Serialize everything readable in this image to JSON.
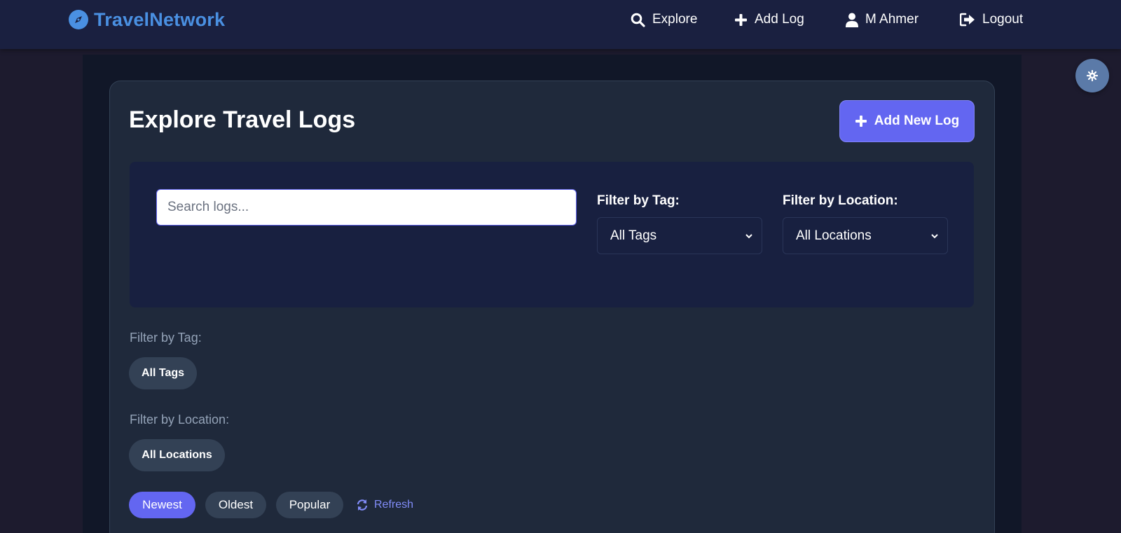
{
  "brand": {
    "name": "TravelNetwork",
    "icon": "compass-icon",
    "color": "#4a90e2"
  },
  "nav": {
    "items": [
      {
        "label": "Explore",
        "icon": "search-icon"
      },
      {
        "label": "Add Log",
        "icon": "plus-icon"
      },
      {
        "label": "M Ahmer",
        "icon": "user-icon"
      },
      {
        "label": "Logout",
        "icon": "logout-icon"
      }
    ]
  },
  "page": {
    "title": "Explore Travel Logs",
    "add_button_label": "Add New Log"
  },
  "filters": {
    "search_placeholder": "Search logs...",
    "tag_label": "Filter by Tag:",
    "tag_selected": "All Tags",
    "location_label": "Filter by Location:",
    "location_selected": "All Locations"
  },
  "tag_pills": {
    "label": "Filter by Tag:",
    "items": [
      "All Tags"
    ]
  },
  "location_pills": {
    "label": "Filter by Location:",
    "items": [
      "All Locations"
    ]
  },
  "sort": {
    "options": [
      "Newest",
      "Oldest",
      "Popular"
    ],
    "active": "Newest",
    "refresh_label": "Refresh"
  },
  "theme_toggle": {
    "icon": "gear-icon"
  },
  "colors": {
    "accent": "#6366f1",
    "navbar": "#1a2040",
    "card": "#1f293b",
    "panel": "#182040",
    "pill": "#334155"
  }
}
